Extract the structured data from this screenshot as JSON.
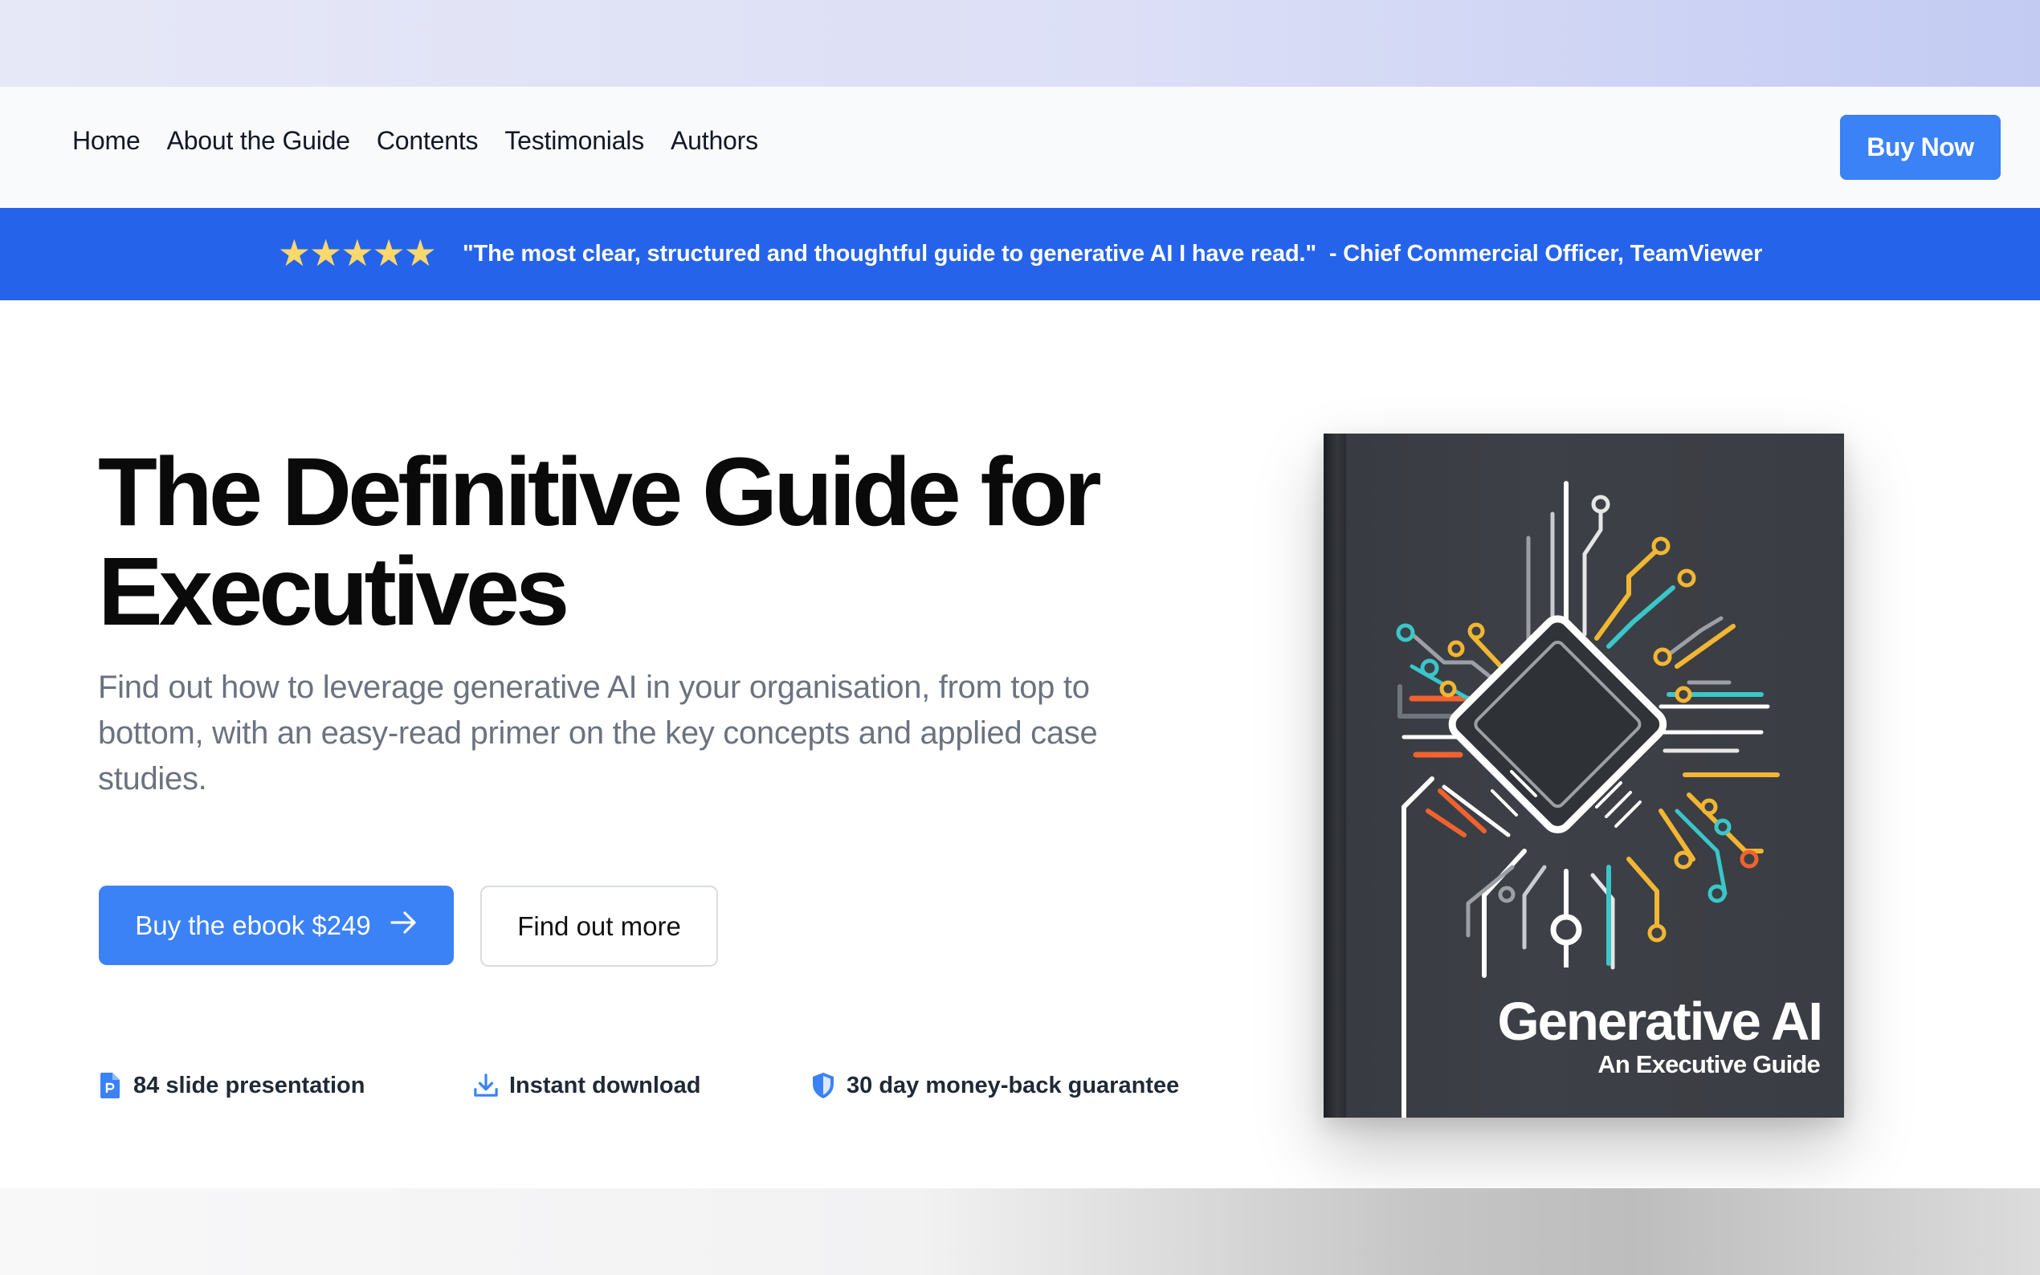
{
  "nav": {
    "links": [
      "Home",
      "About the Guide",
      "Contents",
      "Testimonials",
      "Authors"
    ],
    "cta_label": "Buy Now"
  },
  "banner": {
    "stars": "★★★★★",
    "rating": 5,
    "quote": "\"The most clear, structured and thoughtful guide to generative AI I have read.\"",
    "author": "- Chief Commercial Officer, TeamViewer"
  },
  "hero": {
    "headline": "The Definitive Guide for Executives",
    "subhead": "Find out how to leverage generative AI in your organisation, from top to bottom, with an easy-read primer on the key concepts and applied case studies.",
    "primary_button": "Buy the ebook $249",
    "secondary_button": "Find out more",
    "features": [
      {
        "icon": "presentation-file-icon",
        "label": "84 slide presentation"
      },
      {
        "icon": "download-icon",
        "label": "Instant download"
      },
      {
        "icon": "shield-icon",
        "label": "30 day money-back guarantee"
      }
    ]
  },
  "book": {
    "title": "Generative AI",
    "subtitle": "An Executive Guide"
  },
  "colors": {
    "primary": "#3b82f6",
    "banner": "#2563eb",
    "star": "#fcd86b",
    "book_cover": "#3d4046"
  }
}
